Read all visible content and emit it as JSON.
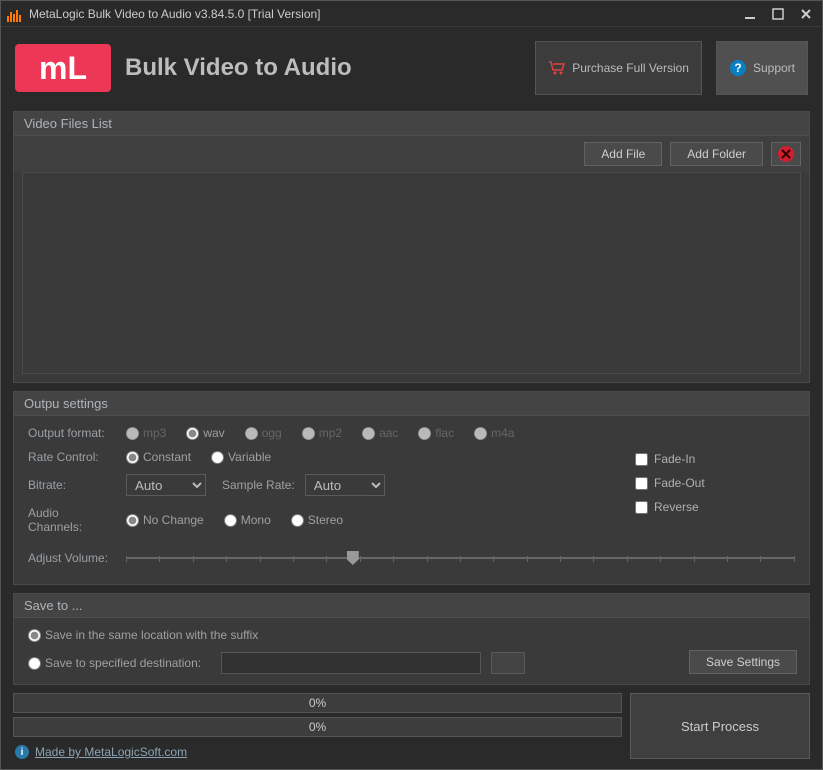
{
  "window": {
    "title": "MetaLogic Bulk Video to Audio v3.84.5.0 [Trial Version]"
  },
  "header": {
    "logo_text": "mL",
    "app_name": "Bulk Video to Audio",
    "purchase": "Purchase Full Version",
    "support": "Support"
  },
  "files": {
    "panel_title": "Video Files List",
    "add_file": "Add File",
    "add_folder": "Add Folder"
  },
  "settings": {
    "panel_title": "Outpu settings",
    "output_format_label": "Output format:",
    "formats": {
      "mp3": "mp3",
      "wav": "wav",
      "ogg": "ogg",
      "mp2": "mp2",
      "aac": "aac",
      "flac": "flac",
      "m4a": "m4a"
    },
    "rate_control_label": "Rate Control:",
    "rate_constant": "Constant",
    "rate_variable": "Variable",
    "bitrate_label": "Bitrate:",
    "bitrate_value": "Auto",
    "sample_rate_label": "Sample Rate:",
    "sample_rate_value": "Auto",
    "channels_label": "Audio Channels:",
    "ch_nochange": "No Change",
    "ch_mono": "Mono",
    "ch_stereo": "Stereo",
    "fade_in": "Fade-In",
    "fade_out": "Fade-Out",
    "reverse": "Reverse",
    "adjust_volume_label": "Adjust Volume:"
  },
  "saveto": {
    "panel_title": "Save to ...",
    "same_location": "Save in the same location with the suffix",
    "specified": "Save to specified destination:",
    "save_settings": "Save Settings"
  },
  "bottom": {
    "progress1": "0%",
    "progress2": "0%",
    "start": "Start Process"
  },
  "footer": {
    "made_by": "Made by MetaLogicSoft.com"
  }
}
